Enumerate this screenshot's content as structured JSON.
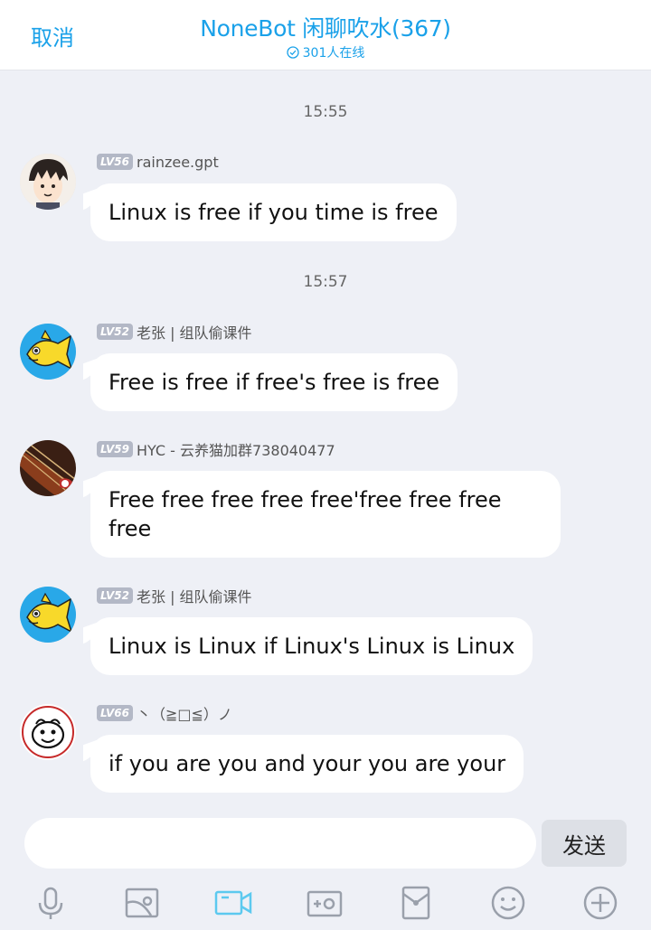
{
  "header": {
    "cancel_label": "取消",
    "title": "NoneBot 闲聊吹水(367)",
    "online_text": "301人在线"
  },
  "messages": [
    {
      "time": "15:55",
      "level": "LV56",
      "sender": "rainzee.gpt",
      "text": "Linux is free if you time is free",
      "avatar": "anime-boy-avatar"
    },
    {
      "time": "15:57",
      "level": "LV52",
      "sender": "老张 | 组队偷课件",
      "text": "Free is free if free's free is free",
      "avatar": "yellow-fish-avatar"
    },
    {
      "level": "LV59",
      "sender": "HYC - 云养猫加群738040477",
      "text": "Free free free free free'free free free free",
      "avatar": "violin-avatar"
    },
    {
      "level": "LV52",
      "sender": "老张 | 组队偷课件",
      "text": "Linux is Linux if Linux's Linux is Linux",
      "avatar": "yellow-fish-avatar"
    },
    {
      "level": "LV66",
      "sender": "丶（≧□≦）ノ",
      "text": "if you are you and your you are your",
      "avatar": "face-sticker-avatar"
    }
  ],
  "composer": {
    "input_value": "",
    "send_label": "发送"
  },
  "toolbar": {
    "icons": [
      "microphone-icon",
      "image-icon",
      "video-icon",
      "camera-icon",
      "red-packet-icon",
      "emoji-icon",
      "plus-icon"
    ],
    "active_color": "#5cc9ef",
    "icon_color": "#9aa0ab"
  },
  "colors": {
    "accent": "#1aa1e9",
    "background": "#eef0f6",
    "bubble": "#ffffff",
    "level_badge": "#b3b8c6"
  }
}
